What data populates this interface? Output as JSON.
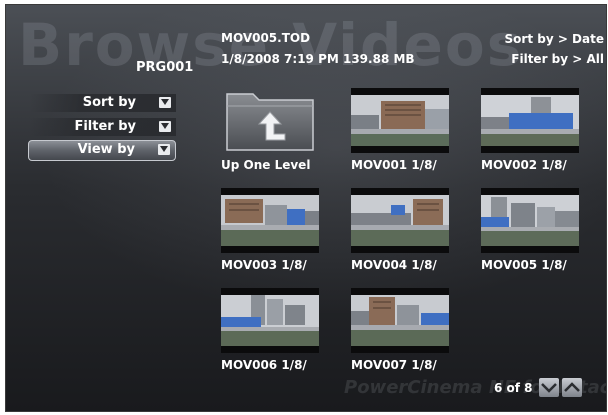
{
  "screen": {
    "background_title": "Browse Videos",
    "brand": "PowerCinema NE for Hitachi",
    "folder_name": "PRG001"
  },
  "selected_file": {
    "name": "MOV005.TOD",
    "meta": "1/8/2008 7:19 PM 139.88 MB"
  },
  "status": {
    "sort": "Sort by > Date",
    "filter": "Filter by > All"
  },
  "menu": {
    "sort_label": "Sort by",
    "filter_label": "Filter by",
    "view_label": "View by"
  },
  "tiles": [
    {
      "label": "Up One Level",
      "kind": "folder-up"
    },
    {
      "label": "MOV001 1/8/",
      "kind": "video"
    },
    {
      "label": "MOV002 1/8/",
      "kind": "video"
    },
    {
      "label": "MOV003 1/8/",
      "kind": "video"
    },
    {
      "label": "MOV004 1/8/",
      "kind": "video"
    },
    {
      "label": "MOV005 1/8/",
      "kind": "video"
    },
    {
      "label": "MOV006 1/8/",
      "kind": "video"
    },
    {
      "label": "MOV007 1/8/",
      "kind": "video"
    }
  ],
  "pagination": {
    "indicator": "6 of 8",
    "page_down_icon": "chevron-down-icon",
    "page_up_icon": "chevron-up-icon"
  },
  "colors": {
    "text": "#ffffff",
    "menu_highlight": "#6a6e75",
    "sky": "#c8ccd2",
    "building_blue": "#3f6fc2"
  }
}
